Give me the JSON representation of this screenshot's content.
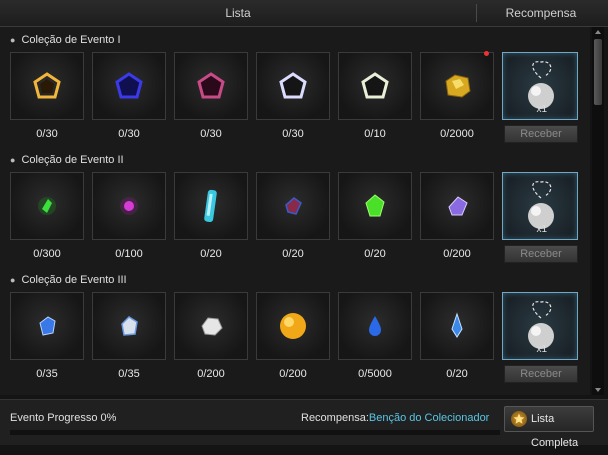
{
  "header": {
    "list_label": "Lista",
    "reward_label": "Recompensa"
  },
  "groups": [
    {
      "title": "Coleção de Evento I",
      "counts": [
        "0/30",
        "0/30",
        "0/30",
        "0/30",
        "0/10",
        "0/2000"
      ],
      "reward_qty": "x1",
      "receive_label": "Receber"
    },
    {
      "title": "Coleção de Evento II",
      "counts": [
        "0/300",
        "0/100",
        "0/20",
        "0/20",
        "0/20",
        "0/200"
      ],
      "reward_qty": "x1",
      "receive_label": "Receber"
    },
    {
      "title": "Coleção de Evento III",
      "counts": [
        "0/35",
        "0/35",
        "0/200",
        "0/200",
        "0/5000",
        "0/20"
      ],
      "reward_qty": "x1",
      "receive_label": "Receber"
    }
  ],
  "footer": {
    "progress_label": "Evento Progresso 0%",
    "progress_fraction": 0,
    "reward_prefix": "Recompensa:",
    "reward_name": "Benção do Colecionador",
    "full_list_label": "Lista Completa"
  },
  "colors": {
    "accent": "#58c6e6",
    "notice_dot": "#e33333"
  }
}
